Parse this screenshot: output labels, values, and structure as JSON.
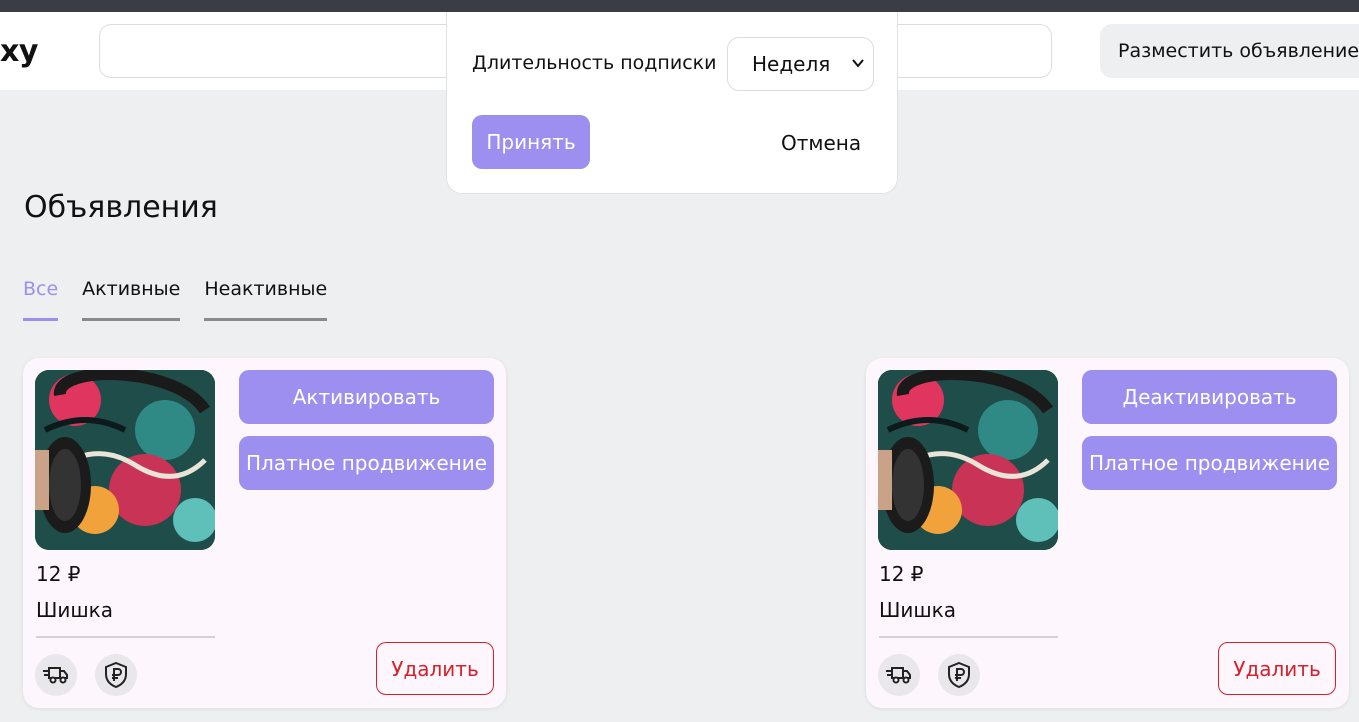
{
  "header": {
    "logo_text": "xy",
    "search_value": "",
    "post_button": "Разместить объявление"
  },
  "page": {
    "title": "Объявления",
    "tabs": [
      {
        "label": "Все",
        "active": true
      },
      {
        "label": "Активные",
        "active": false
      },
      {
        "label": "Неактивные",
        "active": false
      }
    ]
  },
  "listings": [
    {
      "price": "12 ₽",
      "name": "Шишка",
      "primary_action": "Активировать",
      "promo_action": "Платное продвижение",
      "delete_action": "Удалить",
      "icons": [
        "delivery-truck-icon",
        "ruble-shield-icon"
      ]
    },
    {
      "price": "12 ₽",
      "name": "Шишка",
      "primary_action": "Деактивировать",
      "promo_action": "Платное продвижение",
      "delete_action": "Удалить",
      "icons": [
        "delivery-truck-icon",
        "ruble-shield-icon"
      ]
    }
  ],
  "modal": {
    "label": "Длительность подписки",
    "selected_duration": "Неделя",
    "accept_label": "Принять",
    "cancel_label": "Отмена"
  },
  "colors": {
    "accent": "#9c8ff0",
    "danger": "#d8202b",
    "page_bg": "#eeeff1",
    "card_bg": "#fdf7fd"
  }
}
